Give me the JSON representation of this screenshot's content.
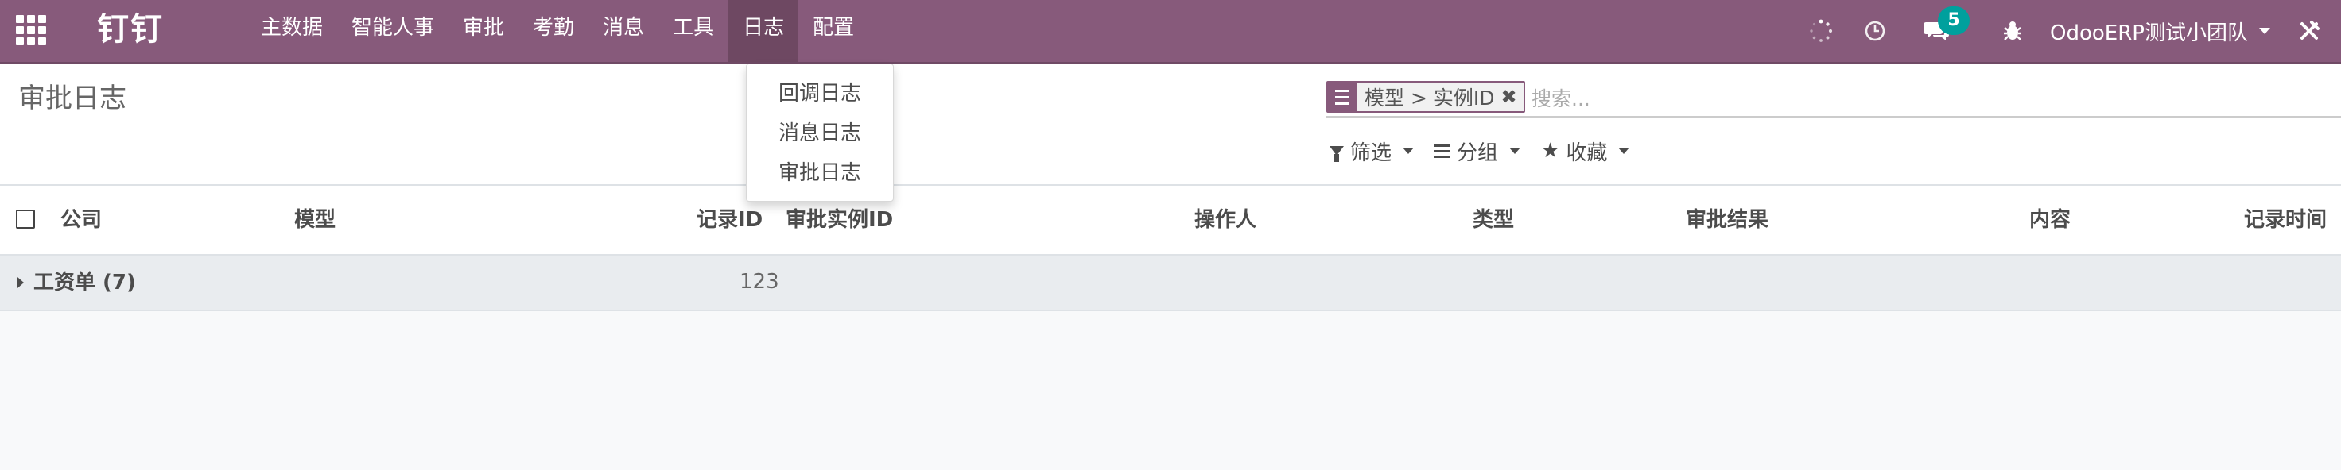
{
  "navbar": {
    "brand": "钉钉",
    "menu": [
      {
        "label": "主数据"
      },
      {
        "label": "智能人事"
      },
      {
        "label": "审批"
      },
      {
        "label": "考勤"
      },
      {
        "label": "消息"
      },
      {
        "label": "工具"
      },
      {
        "label": "日志",
        "active": true
      },
      {
        "label": "配置"
      }
    ],
    "systray": {
      "messages_count": "5",
      "user_name": "OdooERP测试小团队"
    },
    "icons": [
      "apps-icon",
      "spinner-icon",
      "clock-icon",
      "chat-icon",
      "bug-icon",
      "debug-close-icon"
    ]
  },
  "dropdown": {
    "items": [
      {
        "label": "回调日志"
      },
      {
        "label": "消息日志"
      },
      {
        "label": "审批日志"
      }
    ]
  },
  "control_panel": {
    "title": "审批日志",
    "search": {
      "facet": "模型 > 实例ID",
      "placeholder": "搜索..."
    },
    "filters": {
      "filter_label": "筛选",
      "group_label": "分组",
      "favorites_label": "收藏"
    }
  },
  "list": {
    "columns": [
      "公司",
      "模型",
      "记录ID",
      "审批实例ID",
      "操作人",
      "类型",
      "审批结果",
      "内容",
      "记录时间"
    ],
    "groups": [
      {
        "label": "工资单 (7)",
        "record_id_sum": "123"
      }
    ]
  },
  "colors": {
    "navbar": "#875a7b",
    "active_menu": "#6e4862",
    "badge": "#00a09d"
  }
}
